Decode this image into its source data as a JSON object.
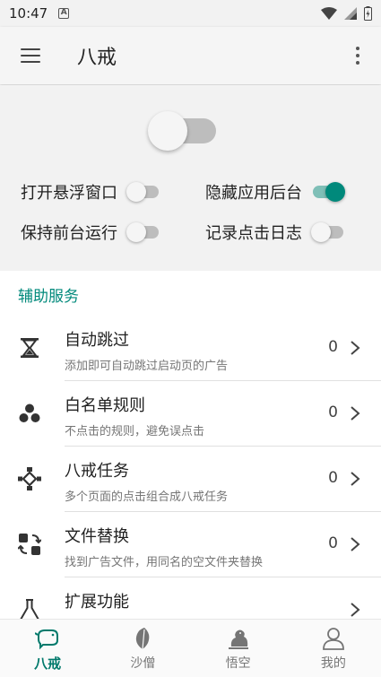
{
  "status_bar": {
    "time": "10:47",
    "notification_badge": "A",
    "battery_level": "low"
  },
  "app_bar": {
    "title": "八戒"
  },
  "main_switch": {
    "on": false
  },
  "options": [
    {
      "label": "打开悬浮窗口",
      "on": false
    },
    {
      "label": "隐藏应用后台",
      "on": true
    },
    {
      "label": "保持前台运行",
      "on": false
    },
    {
      "label": "记录点击日志",
      "on": false
    }
  ],
  "section": {
    "title": "辅助服务"
  },
  "services": [
    {
      "icon": "hourglass-icon",
      "name": "自动跳过",
      "desc": "添加即可自动跳过启动页的广告",
      "count": "0"
    },
    {
      "icon": "three-dots-cluster-icon",
      "name": "白名单规则",
      "desc": "不点击的规则，避免误点击",
      "count": "0"
    },
    {
      "icon": "workflow-icon",
      "name": "八戒任务",
      "desc": "多个页面的点击组合成八戒任务",
      "count": "0"
    },
    {
      "icon": "file-swap-icon",
      "name": "文件替换",
      "desc": "找到广告文件，用同名的空文件夹替换",
      "count": "0"
    },
    {
      "icon": "flask-icon",
      "name": "扩展功能",
      "desc": "",
      "count": ""
    }
  ],
  "bottom_nav": [
    {
      "label": "八戒",
      "icon": "pig-icon",
      "active": true
    },
    {
      "label": "沙僧",
      "icon": "leaf-icon",
      "active": false
    },
    {
      "label": "悟空",
      "icon": "monkey-icon",
      "active": false
    },
    {
      "label": "我的",
      "icon": "person-icon",
      "active": false
    }
  ],
  "colors": {
    "accent": "#00897b",
    "switch_on_track": "#7fbfb7",
    "switch_off_track": "#bdbdbd",
    "background": "#f2f2f2"
  }
}
